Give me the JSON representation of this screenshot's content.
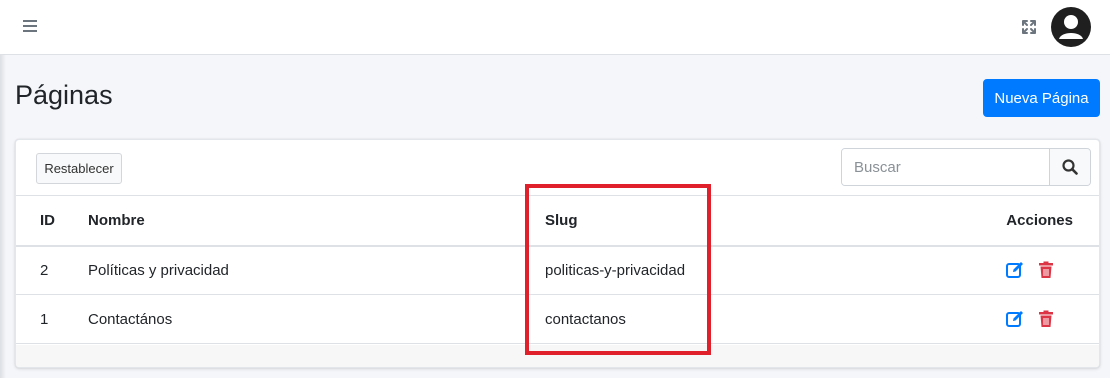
{
  "header": {
    "menu_icon": "hamburger-icon",
    "fullscreen_icon": "expand-icon",
    "user_icon": "user-avatar-icon"
  },
  "page": {
    "title": "Páginas",
    "new_button_label": "Nueva Página"
  },
  "toolbar": {
    "reset_label": "Restablecer",
    "search_placeholder": "Buscar",
    "search_value": "",
    "search_icon": "search-icon"
  },
  "table": {
    "columns": [
      "ID",
      "Nombre",
      "Slug",
      "Acciones"
    ],
    "rows": [
      {
        "id": "2",
        "nombre": "Políticas y privacidad",
        "slug": "politicas-y-privacidad"
      },
      {
        "id": "1",
        "nombre": "Contactános",
        "slug": "contactanos"
      }
    ],
    "row_actions": [
      "edit-icon",
      "delete-icon"
    ]
  },
  "colors": {
    "primary": "#007bff",
    "danger": "#dc3545",
    "highlight": "#e0202a",
    "background": "#f4f6f9"
  }
}
